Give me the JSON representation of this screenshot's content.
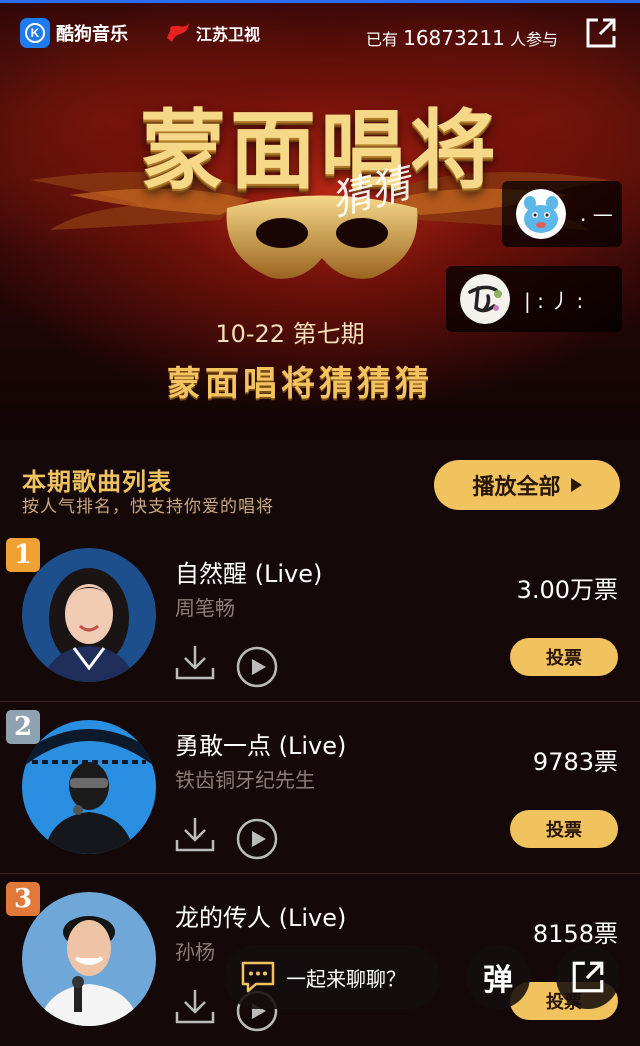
{
  "header": {
    "brand_name": "酷狗音乐",
    "partner_name": "江苏卫视",
    "participants_prefix": "已有",
    "participants_count": "16873211",
    "participants_suffix": "人参与"
  },
  "banner": {
    "show_title": "蒙面唱将",
    "signature": "猜猜",
    "episode": "10-22 第七期",
    "subtitle": "蒙面唱将猜猜猜",
    "comments": [
      {
        "text": ". —",
        "avatar": "blue-cartoon-avatar"
      },
      {
        "text": "| : 丿 :",
        "avatar": "ink-calligraphy-avatar"
      }
    ]
  },
  "song_list": {
    "title": "本期歌曲列表",
    "subtitle": "按人气排名，快支持你爱的唱将",
    "play_all_label": "播放全部",
    "vote_label": "投票",
    "songs": [
      {
        "rank": "1",
        "title": "自然醒 (Live)",
        "artist": "周笔畅",
        "votes": "3.00万票",
        "rank_color": "#f0a134"
      },
      {
        "rank": "2",
        "title": "勇敢一点 (Live)",
        "artist": "铁齿铜牙纪先生",
        "votes": "9783票",
        "rank_color": "#8fa2b2"
      },
      {
        "rank": "3",
        "title": "龙的传人 (Live)",
        "artist": "孙杨",
        "votes": "8158票",
        "rank_color": "#e0793a"
      }
    ]
  },
  "floating_bar": {
    "chat_label": "一起来聊聊？",
    "danmu_label": "弹"
  },
  "colors": {
    "accent_gold": "#f0c35e",
    "brand_blue": "#1e7cf0",
    "background": "#140808"
  }
}
